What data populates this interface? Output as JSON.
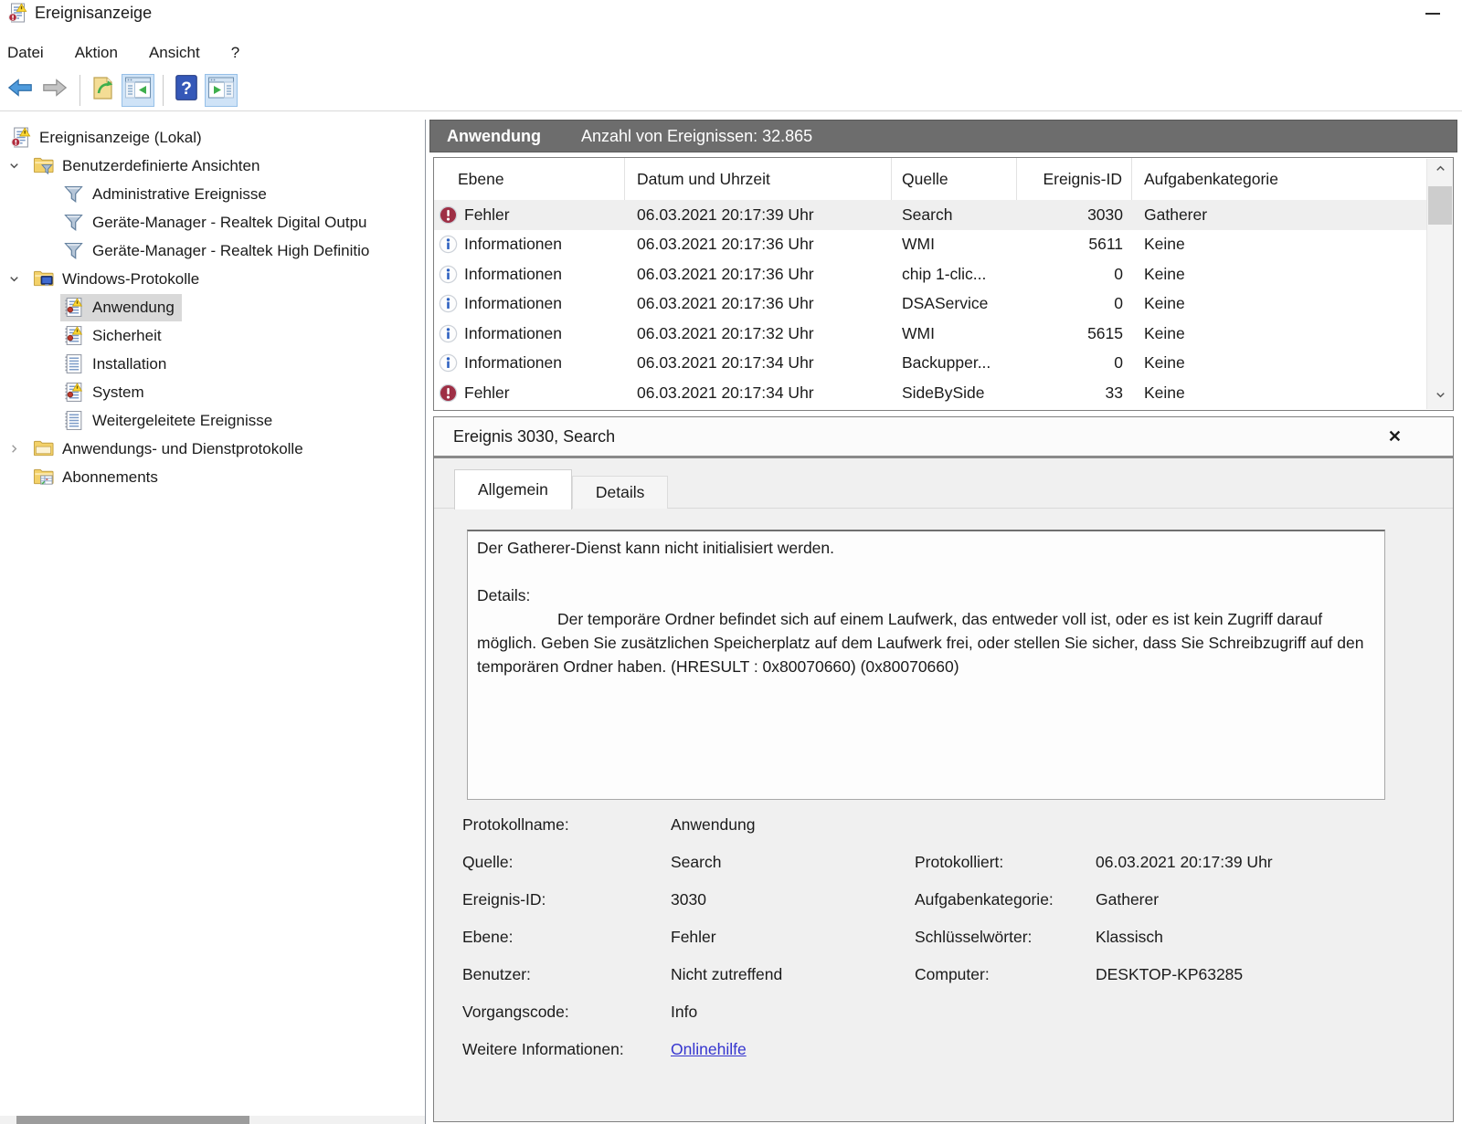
{
  "window": {
    "title": "Ereignisanzeige",
    "minimize_glyph": "—"
  },
  "menu": {
    "items": [
      "Datei",
      "Aktion",
      "Ansicht",
      "?"
    ]
  },
  "toolbar": {
    "buttons": [
      {
        "name": "back",
        "icon": "back-arrow"
      },
      {
        "name": "forward",
        "icon": "forward-arrow"
      },
      {
        "name": "open-saved-log",
        "icon": "import-document"
      },
      {
        "name": "toggle-console-tree",
        "icon": "console-tree-window",
        "highlighted": true
      },
      {
        "name": "help",
        "icon": "help-question"
      },
      {
        "name": "toggle-action-pane",
        "icon": "action-pane-window",
        "highlighted": true
      }
    ]
  },
  "tree": {
    "items": [
      {
        "label": "Ereignisanzeige (Lokal)",
        "icon": "eventviewer",
        "level": 0,
        "chevron": "none"
      },
      {
        "label": "Benutzerdefinierte Ansichten",
        "icon": "folder-filter",
        "level": 1,
        "chevron": "down"
      },
      {
        "label": "Administrative Ereignisse",
        "icon": "filter",
        "level": 2,
        "chevron": "none"
      },
      {
        "label": "Geräte-Manager - Realtek Digital Outpu",
        "icon": "filter",
        "level": 2,
        "chevron": "none"
      },
      {
        "label": "Geräte-Manager - Realtek High Definitio",
        "icon": "filter",
        "level": 2,
        "chevron": "none"
      },
      {
        "label": "Windows-Protokolle",
        "icon": "folder-monitor",
        "level": 1,
        "chevron": "down"
      },
      {
        "label": "Anwendung",
        "icon": "log-alert",
        "level": 2,
        "chevron": "none",
        "selected": true
      },
      {
        "label": "Sicherheit",
        "icon": "log-alert",
        "level": 2,
        "chevron": "none"
      },
      {
        "label": "Installation",
        "icon": "log",
        "level": 2,
        "chevron": "none"
      },
      {
        "label": "System",
        "icon": "log-alert",
        "level": 2,
        "chevron": "none"
      },
      {
        "label": "Weitergeleitete Ereignisse",
        "icon": "log",
        "level": 2,
        "chevron": "none"
      },
      {
        "label": "Anwendungs- und Dienstprotokolle",
        "icon": "folder",
        "level": 1,
        "chevron": "right"
      },
      {
        "label": "Abonnements",
        "icon": "folder-table",
        "level": 1,
        "chevron": "none"
      }
    ]
  },
  "main": {
    "header": {
      "title": "Anwendung",
      "count": "Anzahl von Ereignissen: 32.865"
    },
    "table": {
      "columns": [
        "Ebene",
        "Datum und Uhrzeit",
        "Quelle",
        "Ereignis-ID",
        "Aufgabenkategorie"
      ],
      "rows": [
        {
          "level": "Fehler",
          "icon": "error",
          "date": "06.03.2021 20:17:39 Uhr",
          "source": "Search",
          "id": "3030",
          "category": "Gatherer",
          "selected": true
        },
        {
          "level": "Informationen",
          "icon": "info",
          "date": "06.03.2021 20:17:36 Uhr",
          "source": "WMI",
          "id": "5611",
          "category": "Keine"
        },
        {
          "level": "Informationen",
          "icon": "info",
          "date": "06.03.2021 20:17:36 Uhr",
          "source": "chip 1-clic...",
          "id": "0",
          "category": "Keine"
        },
        {
          "level": "Informationen",
          "icon": "info",
          "date": "06.03.2021 20:17:36 Uhr",
          "source": "DSAService",
          "id": "0",
          "category": "Keine"
        },
        {
          "level": "Informationen",
          "icon": "info",
          "date": "06.03.2021 20:17:32 Uhr",
          "source": "WMI",
          "id": "5615",
          "category": "Keine"
        },
        {
          "level": "Informationen",
          "icon": "info",
          "date": "06.03.2021 20:17:34 Uhr",
          "source": "Backupper...",
          "id": "0",
          "category": "Keine"
        },
        {
          "level": "Fehler",
          "icon": "error",
          "date": "06.03.2021 20:17:34 Uhr",
          "source": "SideBySide",
          "id": "33",
          "category": "Keine"
        }
      ]
    },
    "details": {
      "title": "Ereignis 3030, Search",
      "close_glyph": "✕",
      "tabs": [
        {
          "label": "Allgemein",
          "active": true
        },
        {
          "label": "Details",
          "active": false
        }
      ],
      "message": {
        "line1": "Der Gatherer-Dienst kann nicht initialisiert werden.",
        "details_label": "Details:",
        "body": "Der temporäre Ordner befindet sich auf einem Laufwerk, das entweder voll ist, oder es ist kein Zugriff darauf möglich. Geben Sie zusätzlichen Speicherplatz auf dem Laufwerk frei, oder stellen Sie sicher, dass Sie Schreibzugriff auf den temporären Ordner haben.  (HRESULT : 0x80070660) (0x80070660)"
      },
      "fields_left": [
        {
          "label": "Protokollname:",
          "value": "Anwendung"
        },
        {
          "label": "Quelle:",
          "value": "Search"
        },
        {
          "label": "Ereignis-ID:",
          "value": "3030"
        },
        {
          "label": "Ebene:",
          "value": "Fehler"
        },
        {
          "label": "Benutzer:",
          "value": "Nicht zutreffend"
        },
        {
          "label": "Vorgangscode:",
          "value": "Info"
        },
        {
          "label": "Weitere Informationen:",
          "value": "Onlinehilfe",
          "link": true
        }
      ],
      "fields_right": [
        {
          "label": "Protokolliert:",
          "value": "06.03.2021 20:17:39 Uhr"
        },
        {
          "label": "Aufgabenkategorie:",
          "value": "Gatherer"
        },
        {
          "label": "Schlüsselwörter:",
          "value": "Klassisch"
        },
        {
          "label": "Computer:",
          "value": "DESKTOP-KP63285"
        }
      ]
    }
  },
  "colors": {
    "list_header_bg": "#6d6d6d",
    "tree_selection": "#d9d9d9",
    "row_selection": "#efefef",
    "link": "#3535cf",
    "error_icon": "#9e2f45",
    "info_icon": "#2b5fc0",
    "toolbar_highlight": "#cfe3f7"
  }
}
